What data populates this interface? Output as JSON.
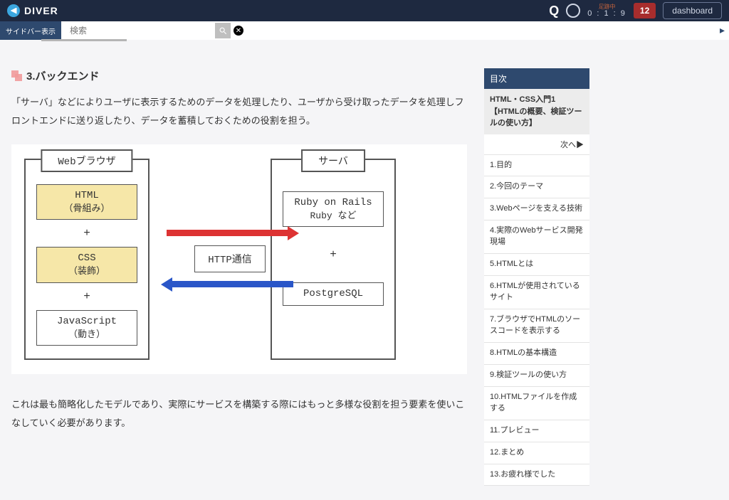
{
  "topbar": {
    "brand": "DIVER",
    "timer_label": "足跡中",
    "timer_value": "0 : 1 : 9",
    "badge": "12",
    "dashboard": "dashboard"
  },
  "search": {
    "sidebar_toggle": "サイドバー表示",
    "placeholder": "検索"
  },
  "section": {
    "heading": "3.バックエンド",
    "paragraph": "「サーバ」などによりユーザに表示するためのデータを処理したり、ユーザから受け取ったデータを処理しフロントエンドに送り返したり、データを蓄積しておくための役割を担う。",
    "footer_text": "これは最も簡略化したモデルであり、実際にサービスを構築する際にはもっと多様な役割を担う要素を使いこなしていく必要があります。"
  },
  "diagram": {
    "left_title": "Webブラウザ",
    "right_title": "サーバ",
    "http_label": "HTTP通信",
    "plus": "+",
    "left_items": [
      {
        "name": "HTML",
        "sub": "（骨組み）",
        "hl": true
      },
      {
        "name": "CSS",
        "sub": "（装飾）",
        "hl": true
      },
      {
        "name": "JavaScript",
        "sub": "（動き）",
        "hl": false
      }
    ],
    "right_items": [
      {
        "line1": "Ruby on Rails",
        "line2": "Ruby など"
      },
      {
        "line1": "PostgreSQL",
        "line2": ""
      }
    ]
  },
  "toc": {
    "header": "目次",
    "title": "HTML・CSS入門1【HTMLの概要、検証ツールの使い方】",
    "next": "次へ▶",
    "items": [
      "1.目的",
      "2.今回のテーマ",
      "3.Webページを支える技術",
      "4.実際のWebサービス開発現場",
      "5.HTMLとは",
      "6.HTMLが使用されているサイト",
      "7.ブラウザでHTMLのソースコードを表示する",
      "8.HTMLの基本構造",
      "9.検証ツールの使い方",
      "10.HTMLファイルを作成する",
      "11.プレビュー",
      "12.まとめ",
      "13.お疲れ様でした"
    ]
  }
}
